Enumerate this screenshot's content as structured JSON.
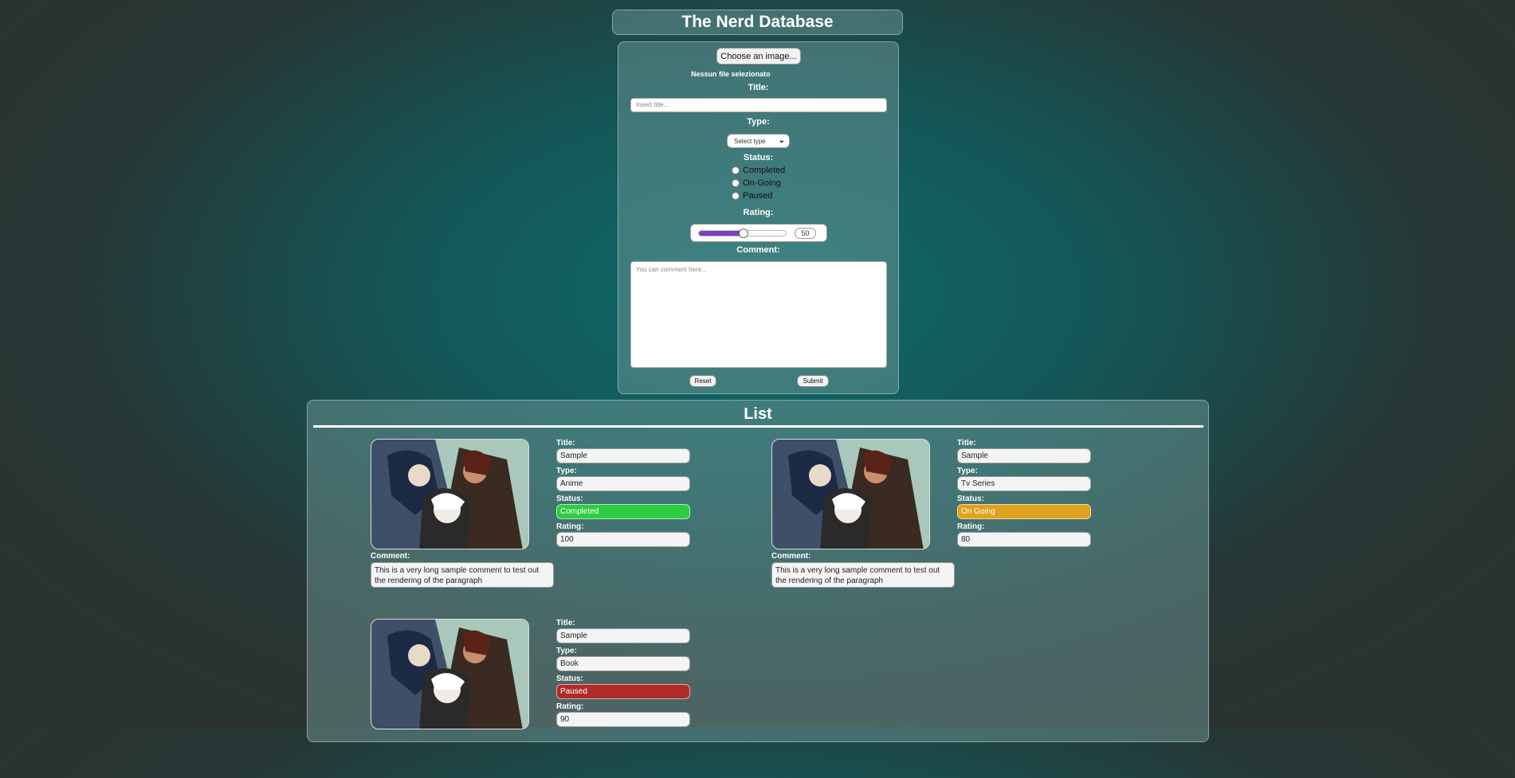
{
  "app": {
    "title": "The Nerd Database"
  },
  "form": {
    "choose_image_label": "Choose an image...",
    "no_file_text": "Nessun file selezionato",
    "title_label": "Title:",
    "title_placeholder": "Insert title...",
    "type_label": "Type:",
    "type_selected": "Select type",
    "status_label": "Status:",
    "status_options": [
      "Completed",
      "On-Going",
      "Paused"
    ],
    "rating_label": "Rating:",
    "rating_value": "50",
    "rating_fraction": 0.5,
    "comment_label": "Comment:",
    "comment_placeholder": "You can comment here...",
    "reset_label": "Reset",
    "submit_label": "Submit"
  },
  "list": {
    "title": "List",
    "field_labels": {
      "title": "Title:",
      "type": "Type:",
      "status": "Status:",
      "rating": "Rating:",
      "comment": "Comment:"
    },
    "cards": [
      {
        "title": "Sample",
        "type": "Anime",
        "status": "Completed",
        "status_color": "#2ecc40",
        "rating": "100",
        "comment": "This is a very long sample comment to test out the rendering of the paragraph"
      },
      {
        "title": "Sample",
        "type": "Tv Series",
        "status": "On Going",
        "status_color": "#e0a11e",
        "rating": "80",
        "comment": "This is a very long sample comment to test out the rendering of the paragraph"
      },
      {
        "title": "Sample",
        "type": "Book",
        "status": "Paused",
        "status_color": "#b02a2a",
        "rating": "90",
        "comment": ""
      }
    ]
  }
}
